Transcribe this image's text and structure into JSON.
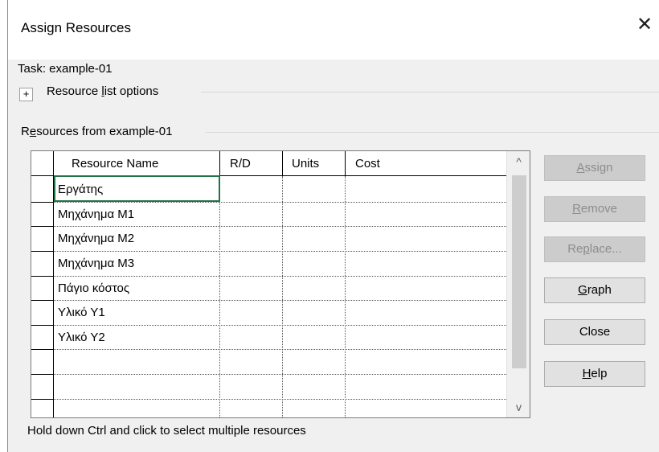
{
  "window": {
    "title": "Assign Resources"
  },
  "task": {
    "label": "Task: example-01"
  },
  "options": {
    "expand_symbol": "+",
    "label_pre": "Resource ",
    "label_key": "l",
    "label_post": "ist options"
  },
  "resources": {
    "label_pre": "R",
    "label_key": "e",
    "label_post": "sources from example-01"
  },
  "table": {
    "headers": [
      "Resource Name",
      "R/D",
      "Units",
      "Cost"
    ],
    "rows": [
      {
        "name": "Εργάτης"
      },
      {
        "name": "Μηχάνημα Μ1"
      },
      {
        "name": "Μηχάνημα Μ2"
      },
      {
        "name": "Μηχάνημα Μ3"
      },
      {
        "name": "Πάγιο κόστος"
      },
      {
        "name": "Υλικό Υ1"
      },
      {
        "name": "Υλικό Υ2"
      },
      {
        "name": ""
      },
      {
        "name": ""
      },
      {
        "name": ""
      }
    ],
    "scroll_up": "^",
    "scroll_down": "v"
  },
  "buttons": {
    "assign": {
      "pre": "",
      "key": "A",
      "post": "ssign",
      "enabled": false
    },
    "remove": {
      "pre": "",
      "key": "R",
      "post": "emove",
      "enabled": false
    },
    "replace": {
      "pre": "Re",
      "key": "p",
      "post": "lace...",
      "enabled": false
    },
    "graph": {
      "pre": "",
      "key": "G",
      "post": "raph",
      "enabled": true
    },
    "close": {
      "label": "Close",
      "enabled": true
    },
    "help": {
      "pre": "",
      "key": "H",
      "post": "elp",
      "enabled": true
    }
  },
  "hint": "Hold down Ctrl and click to select multiple resources",
  "colors": {
    "active_cell_border": "#217346",
    "disabled_text": "#8d8d8d"
  }
}
